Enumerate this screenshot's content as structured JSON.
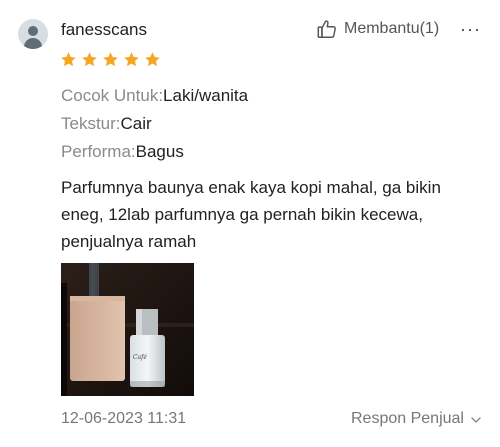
{
  "user": {
    "name": "fanesscans",
    "avatar_icon": "user-avatar-icon"
  },
  "actions": {
    "helpful_label": "Membantu(1)",
    "helpful_icon": "thumbs-up-icon",
    "more_label": "···"
  },
  "rating": {
    "stars": 5,
    "max": 5,
    "color": "#f5a623"
  },
  "attributes": [
    {
      "key": "Cocok Untuk:",
      "value": "Laki/wanita"
    },
    {
      "key": "Tekstur:",
      "value": "Cair"
    },
    {
      "key": "Performa:",
      "value": "Bagus"
    }
  ],
  "review_text": "Parfumnya baunya enak kaya kopi mahal, ga bikin eneg, 12lab parfumnya ga pernah bikin kecewa, penjualnya ramah",
  "photo": {
    "bottle_label": "Café"
  },
  "footer": {
    "date": "12-06-2023 11:31",
    "reply_label": "Respon Penjual",
    "reply_icon": "chevron-down-icon"
  }
}
